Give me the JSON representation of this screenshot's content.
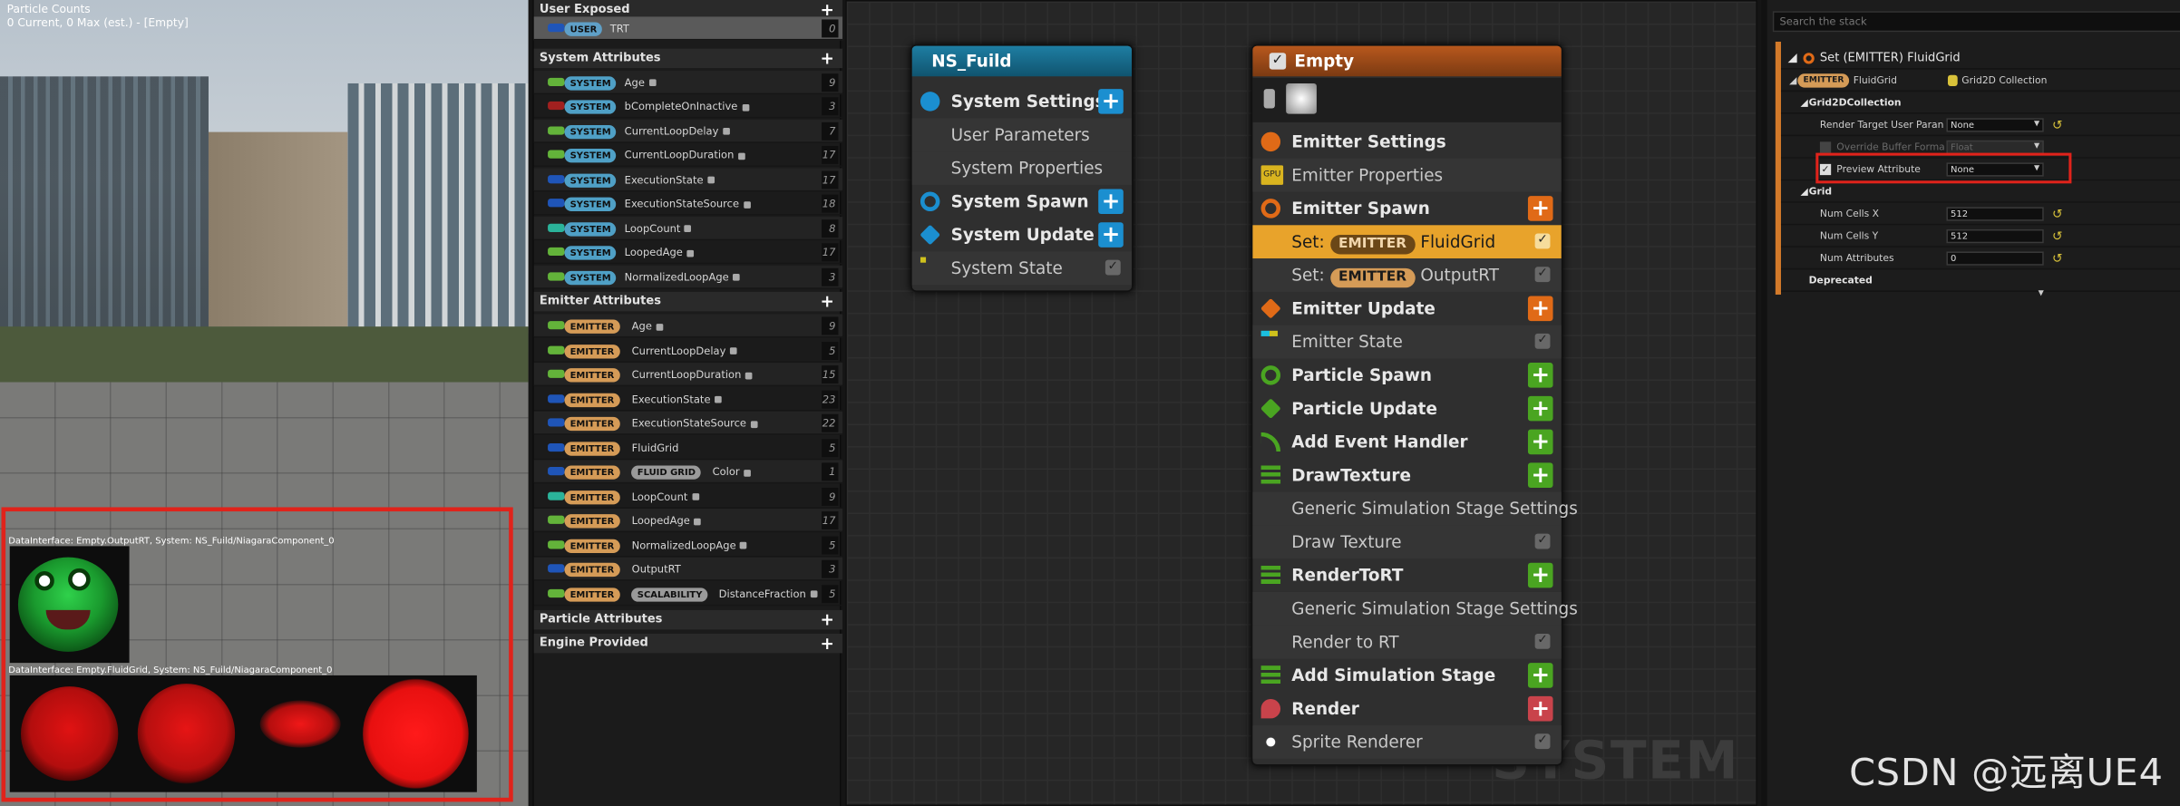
{
  "viewport": {
    "overlay_title": "Particle Counts",
    "overlay_sub": "0 Current, 0 Max (est.) - [Empty]",
    "debug_label_1": "DataInterface: Empty.OutputRT, System: NS_Fuild/NiagaraComponent_0",
    "debug_label_2": "DataInterface: Empty.FluidGrid, System: NS_Fuild/NiagaraComponent_0"
  },
  "params": {
    "user_exposed": "User Exposed",
    "user_row": {
      "tag": "USER",
      "name": "TRT",
      "count": "0"
    },
    "system_attributes": "System Attributes",
    "system_rows": [
      {
        "tag": "SYSTEM",
        "name": "Age",
        "count": "9",
        "color": "#63b33a"
      },
      {
        "tag": "SYSTEM",
        "name": "bCompleteOnInactive",
        "count": "3",
        "color": "#a1201f"
      },
      {
        "tag": "SYSTEM",
        "name": "CurrentLoopDelay",
        "count": "7",
        "color": "#63b33a"
      },
      {
        "tag": "SYSTEM",
        "name": "CurrentLoopDuration",
        "count": "17",
        "color": "#63b33a"
      },
      {
        "tag": "SYSTEM",
        "name": "ExecutionState",
        "count": "17",
        "color": "#1f55b8"
      },
      {
        "tag": "SYSTEM",
        "name": "ExecutionStateSource",
        "count": "18",
        "color": "#1f55b8"
      },
      {
        "tag": "SYSTEM",
        "name": "LoopCount",
        "count": "8",
        "color": "#2bb39a"
      },
      {
        "tag": "SYSTEM",
        "name": "LoopedAge",
        "count": "17",
        "color": "#63b33a"
      },
      {
        "tag": "SYSTEM",
        "name": "NormalizedLoopAge",
        "count": "3",
        "color": "#63b33a"
      }
    ],
    "emitter_attributes": "Emitter Attributes",
    "emitter_rows": [
      {
        "tag": "EMITTER",
        "name": "Age",
        "count": "9",
        "color": "#63b33a"
      },
      {
        "tag": "EMITTER",
        "name": "CurrentLoopDelay",
        "count": "5",
        "color": "#63b33a"
      },
      {
        "tag": "EMITTER",
        "name": "CurrentLoopDuration",
        "count": "15",
        "color": "#63b33a"
      },
      {
        "tag": "EMITTER",
        "name": "ExecutionState",
        "count": "23",
        "color": "#1f55b8"
      },
      {
        "tag": "EMITTER",
        "name": "ExecutionStateSource",
        "count": "22",
        "color": "#1f55b8"
      },
      {
        "tag": "EMITTER",
        "name": "FluidGrid",
        "count": "5",
        "color": "#1f55b8"
      },
      {
        "tag": "EMITTER",
        "tag2": "FLUID GRID",
        "name": "Color",
        "count": "1",
        "color": "#1f55b8"
      },
      {
        "tag": "EMITTER",
        "name": "LoopCount",
        "count": "9",
        "color": "#2bb39a"
      },
      {
        "tag": "EMITTER",
        "name": "LoopedAge",
        "count": "17",
        "color": "#63b33a"
      },
      {
        "tag": "EMITTER",
        "name": "NormalizedLoopAge",
        "count": "5",
        "color": "#63b33a"
      },
      {
        "tag": "EMITTER",
        "name": "OutputRT",
        "count": "3",
        "color": "#1f55b8"
      },
      {
        "tag": "EMITTER",
        "tag2": "SCALABILITY",
        "name": "DistanceFraction",
        "count": "5",
        "color": "#63b33a"
      }
    ],
    "particle_attributes": "Particle Attributes",
    "engine_provided": "Engine Provided"
  },
  "system_node": {
    "title": "NS_Fuild",
    "system_settings": "System Settings",
    "user_parameters": "User Parameters",
    "system_properties": "System Properties",
    "system_spawn": "System Spawn",
    "system_update": "System Update",
    "system_state": "System State"
  },
  "emitter_node": {
    "title": "Empty",
    "emitter_settings": "Emitter Settings",
    "emitter_properties": "Emitter Properties",
    "emitter_spawn": "Emitter Spawn",
    "set_prefix": "Set:",
    "emitter_tag": "EMITTER",
    "set_fluidgrid": "FluidGrid",
    "set_outputrt": "OutputRT",
    "emitter_update": "Emitter Update",
    "emitter_state": "Emitter State",
    "particle_spawn": "Particle Spawn",
    "particle_update": "Particle Update",
    "add_event_handler": "Add Event Handler",
    "draw_texture": "DrawTexture",
    "generic_sim_1": "Generic Simulation Stage Settings",
    "draw_texture_sub": "Draw Texture",
    "render_to_rt": "RenderToRT",
    "generic_sim_2": "Generic Simulation Stage Settings",
    "render_to_rt_sub": "Render to RT",
    "add_sim_stage": "Add Simulation Stage",
    "render": "Render",
    "sprite_renderer": "Sprite Renderer",
    "gpu_badge": "GPU"
  },
  "graph": {
    "watermark": "SYSTEM"
  },
  "details": {
    "search_placeholder": "Search the stack",
    "header": "Set (EMITTER) FluidGrid",
    "emitter_tag": "EMITTER",
    "var_name": "FluidGrid",
    "var_type": "Grid2D Collection",
    "category": "Grid2DCollection",
    "rows": {
      "render_target_label": "Render Target User Paran",
      "render_target_value": "None",
      "override_label": "Override Buffer Forma",
      "override_value": "Float",
      "preview_label": "Preview Attribute",
      "preview_value": "None"
    },
    "grid_category": "Grid",
    "num_cells_x_label": "Num Cells X",
    "num_cells_x": "512",
    "num_cells_y_label": "Num Cells Y",
    "num_cells_y": "512",
    "num_attributes_label": "Num Attributes",
    "num_attributes": "0",
    "deprecated": "Deprecated"
  },
  "watermark": "CSDN @远离UE4",
  "colors": {
    "highlight": "#e0231b",
    "emitter_orange": "#d59b57",
    "add_green": "#4aa521",
    "add_blue": "#1b8fd0",
    "add_orange": "#e06a17",
    "add_red": "#c9434b",
    "selected_row": "#e8a32b"
  }
}
